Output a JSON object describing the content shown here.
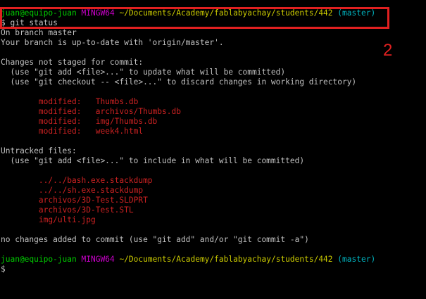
{
  "prompt": {
    "user_host": "juan@equipo-juan",
    "system": "MINGW64",
    "path": "~/Documents/Academy/fablabyachay/students/442",
    "branch": "(master)"
  },
  "command": "$ git status",
  "output": {
    "on_branch": "On branch master",
    "up_to_date": "Your branch is up-to-date with 'origin/master'.",
    "not_staged_header": "Changes not staged for commit:",
    "not_staged_hint1": "  (use \"git add <file>...\" to update what will be committed)",
    "not_staged_hint2": "  (use \"git checkout -- <file>...\" to discard changes in working directory)",
    "modified": [
      {
        "status": "modified:",
        "file": "Thumbs.db"
      },
      {
        "status": "modified:",
        "file": "archivos/Thumbs.db"
      },
      {
        "status": "modified:",
        "file": "img/Thumbs.db"
      },
      {
        "status": "modified:",
        "file": "week4.html"
      }
    ],
    "untracked_header": "Untracked files:",
    "untracked_hint": "  (use \"git add <file>...\" to include in what will be committed)",
    "untracked": [
      "../../bash.exe.stackdump",
      "../../sh.exe.stackdump",
      "archivos/3D-Test.SLDPRT",
      "archivos/3D-Test.STL",
      "img/ulti.jpg"
    ],
    "no_changes": "no changes added to commit (use \"git add\" and/or \"git commit -a\")"
  },
  "prompt2": {
    "user_host": "juan@equipo-juan",
    "system": "MINGW64",
    "path": "~/Documents/Academy/fablabyachay/students/442",
    "branch": "(master)"
  },
  "final_prompt": "$",
  "annotation": "2",
  "colors": {
    "background": "#000000",
    "prompt_user": "#00cc00",
    "prompt_system": "#cc00cc",
    "prompt_path": "#cccc00",
    "prompt_branch": "#00b7c3",
    "file_status": "#cc2222",
    "annotation": "#e02020"
  }
}
